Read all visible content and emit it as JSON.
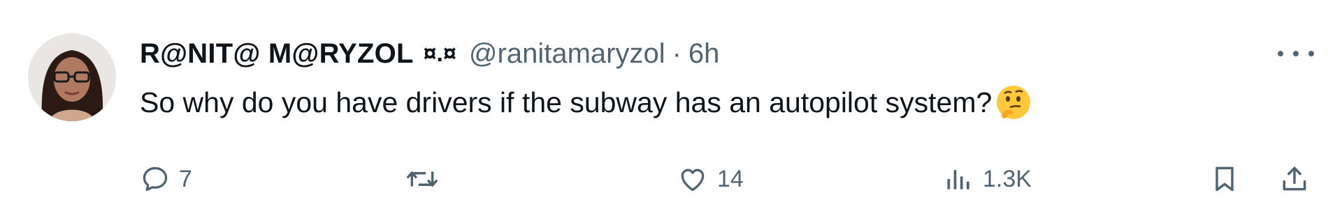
{
  "author": {
    "display_name": "R@NIT@ M@RYZOL",
    "name_badge": "¤.¤",
    "handle": "@ranitamaryzol",
    "separator": "·",
    "time": "6h"
  },
  "tweet": {
    "text": "So why do you have drivers if the subway has an autopilot system?",
    "emoji": "thinking-face"
  },
  "actions": {
    "reply": {
      "icon": "reply-icon",
      "count": "7"
    },
    "retweet": {
      "icon": "retweet-icon",
      "count": ""
    },
    "like": {
      "icon": "heart-icon",
      "count": "14"
    },
    "views": {
      "icon": "views-icon",
      "count": "1.3K"
    },
    "bookmark": {
      "icon": "bookmark-icon"
    },
    "share": {
      "icon": "share-icon"
    }
  },
  "colors": {
    "text_primary": "#0f1419",
    "text_secondary": "#536471",
    "background": "#ffffff"
  }
}
